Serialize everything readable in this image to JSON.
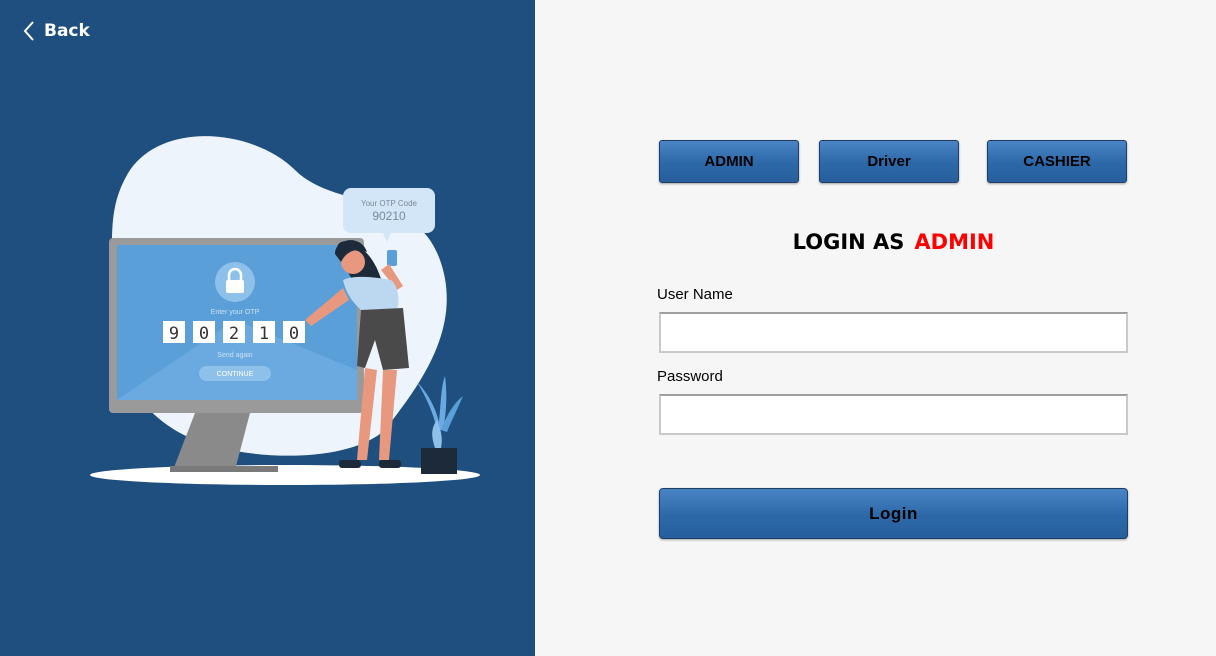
{
  "nav": {
    "back_label": "Back"
  },
  "illustration": {
    "otp_bubble_title": "Your OTP Code",
    "otp_bubble_code": "90210",
    "enter_label": "Enter your OTP",
    "digits": [
      "9",
      "0",
      "2",
      "1",
      "0"
    ],
    "send_again": "Send again",
    "continue_label": "CONTINUE"
  },
  "roles": {
    "admin": "ADMIN",
    "driver": "Driver",
    "cashier": "CASHIER"
  },
  "login": {
    "title_prefix": "LOGIN AS",
    "current_role": "ADMIN",
    "username_label": "User Name",
    "username_value": "",
    "password_label": "Password",
    "password_value": "",
    "submit_label": "Login"
  },
  "colors": {
    "left_panel": "#1e4f7f",
    "accent_red": "#ff0000",
    "button_blue": "#2c68a8"
  }
}
